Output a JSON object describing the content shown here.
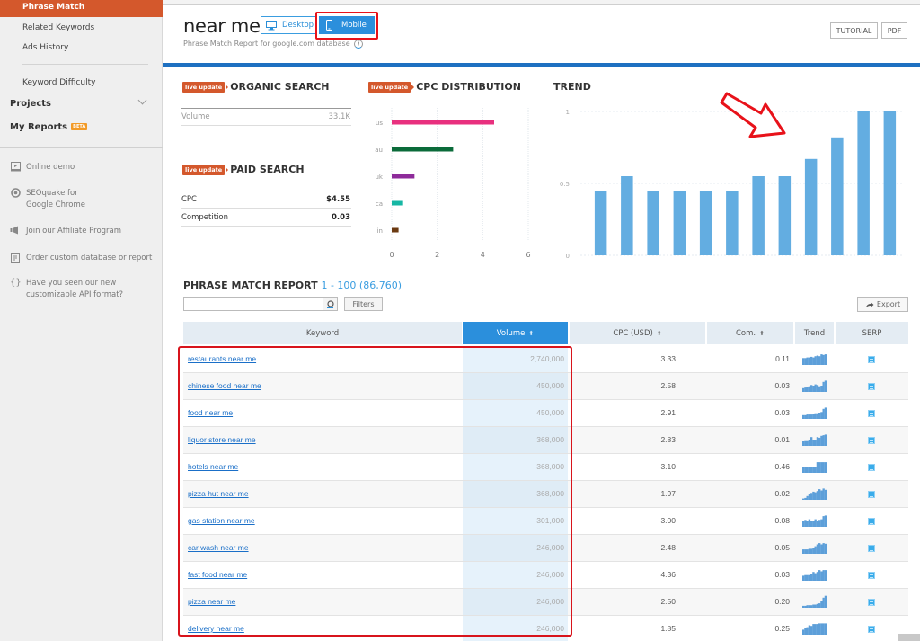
{
  "sidebar": {
    "active_item": "Phrase Match",
    "sub_items": [
      "Related Keywords",
      "Ads History",
      "Keyword Difficulty"
    ],
    "projects_label": "Projects",
    "my_reports_label": "My Reports",
    "beta_badge": "BETA",
    "links": [
      {
        "icon": "monitor-play-icon",
        "label": "Online demo"
      },
      {
        "icon": "target-icon",
        "label": "SEOquake for\nGoogle Chrome"
      },
      {
        "icon": "megaphone-icon",
        "label": "Join our Affiliate Program"
      },
      {
        "icon": "clipboard-icon",
        "label": "Order custom database or report"
      },
      {
        "icon": "braces-icon",
        "label": "Have you seen our new\ncustomizable API format?"
      }
    ]
  },
  "header": {
    "title": "near me",
    "subtitle": "Phrase Match Report for google.com database",
    "info_icon": "i",
    "device_desktop": "Desktop",
    "device_mobile": "Mobile",
    "selected_device": "Mobile",
    "tutorial_label": "TUTORIAL",
    "pdf_label": "PDF"
  },
  "widgets": {
    "live_badge": "live update",
    "organic": {
      "title": "ORGANIC SEARCH",
      "volume_label": "Volume",
      "volume_value": "33.1K"
    },
    "paid": {
      "title": "PAID SEARCH",
      "cpc_label": "CPC",
      "cpc_value": "$4.55",
      "competition_label": "Competition",
      "competition_value": "0.03"
    },
    "cpc_title": "CPC DISTRIBUTION",
    "trend_title": "TREND"
  },
  "chart_data": [
    {
      "type": "bar",
      "orientation": "horizontal",
      "title": "CPC DISTRIBUTION",
      "categories": [
        "us",
        "au",
        "uk",
        "ca",
        "in"
      ],
      "values": [
        4.5,
        2.7,
        1.0,
        0.5,
        0.3
      ],
      "colors": [
        "#e8307e",
        "#0b6b3a",
        "#8e2b9a",
        "#17b7a4",
        "#6b3a12"
      ],
      "xlim": [
        0,
        6
      ],
      "xticks": [
        "0",
        "2",
        "4",
        "6"
      ],
      "grid": true
    },
    {
      "type": "bar",
      "title": "TREND",
      "values": [
        0.45,
        0.55,
        0.45,
        0.45,
        0.45,
        0.45,
        0.55,
        0.55,
        0.67,
        0.82,
        1,
        1
      ],
      "color": "#63ade1",
      "ylim": [
        0,
        1
      ],
      "yticks": [
        "0",
        "0.5",
        "1"
      ],
      "grid": true
    }
  ],
  "report": {
    "title": "PHRASE MATCH REPORT",
    "range": "1 - 100 (86,760)",
    "search_placeholder": "",
    "filters_label": "Filters",
    "export_label": "Export",
    "columns": [
      "Keyword",
      "Volume",
      "CPC (USD)",
      "Com.",
      "Trend",
      "SERP"
    ],
    "sorted_column": "Volume",
    "rows": [
      {
        "keyword": "restaurants near me",
        "volume": "2,740,000",
        "cpc": "3.33",
        "com": "0.11",
        "trend": [
          0.55,
          0.55,
          0.6,
          0.6,
          0.65,
          0.6,
          0.7,
          0.75,
          0.7,
          0.85,
          0.8,
          0.85
        ]
      },
      {
        "keyword": "chinese food near me",
        "volume": "450,000",
        "cpc": "2.58",
        "com": "0.03",
        "trend": [
          0.3,
          0.35,
          0.4,
          0.45,
          0.55,
          0.5,
          0.6,
          0.55,
          0.45,
          0.5,
          0.8,
          0.9
        ]
      },
      {
        "keyword": "food near me",
        "volume": "450,000",
        "cpc": "2.91",
        "com": "0.03",
        "trend": [
          0.3,
          0.3,
          0.35,
          0.35,
          0.35,
          0.4,
          0.45,
          0.45,
          0.5,
          0.55,
          0.8,
          0.9
        ]
      },
      {
        "keyword": "liquor store near me",
        "volume": "368,000",
        "cpc": "2.83",
        "com": "0.01",
        "trend": [
          0.4,
          0.45,
          0.45,
          0.5,
          0.7,
          0.5,
          0.5,
          0.7,
          0.65,
          0.8,
          0.85,
          0.9
        ]
      },
      {
        "keyword": "hotels near me",
        "volume": "368,000",
        "cpc": "3.10",
        "com": "0.46",
        "trend": [
          0.45,
          0.45,
          0.45,
          0.45,
          0.45,
          0.5,
          0.5,
          0.85,
          0.85,
          0.85,
          0.85,
          0.85
        ]
      },
      {
        "keyword": "pizza hut near me",
        "volume": "368,000",
        "cpc": "1.97",
        "com": "0.02",
        "trend": [
          0.1,
          0.15,
          0.3,
          0.45,
          0.55,
          0.65,
          0.6,
          0.7,
          0.85,
          0.75,
          0.9,
          0.8
        ]
      },
      {
        "keyword": "gas station near me",
        "volume": "301,000",
        "cpc": "3.00",
        "com": "0.08",
        "trend": [
          0.5,
          0.55,
          0.5,
          0.6,
          0.5,
          0.5,
          0.6,
          0.5,
          0.55,
          0.6,
          0.85,
          0.9
        ]
      },
      {
        "keyword": "car wash near me",
        "volume": "246,000",
        "cpc": "2.48",
        "com": "0.05",
        "trend": [
          0.35,
          0.35,
          0.35,
          0.4,
          0.4,
          0.45,
          0.6,
          0.75,
          0.85,
          0.75,
          0.85,
          0.8
        ]
      },
      {
        "keyword": "fast food near me",
        "volume": "246,000",
        "cpc": "4.36",
        "com": "0.03",
        "trend": [
          0.4,
          0.45,
          0.45,
          0.45,
          0.5,
          0.7,
          0.6,
          0.7,
          0.85,
          0.75,
          0.85,
          0.85
        ]
      },
      {
        "keyword": "pizza near me",
        "volume": "246,000",
        "cpc": "2.50",
        "com": "0.20",
        "trend": [
          0.15,
          0.15,
          0.2,
          0.2,
          0.2,
          0.25,
          0.25,
          0.3,
          0.35,
          0.5,
          0.8,
          0.95
        ]
      },
      {
        "keyword": "delivery near me",
        "volume": "246,000",
        "cpc": "1.85",
        "com": "0.25",
        "trend": [
          0.4,
          0.5,
          0.6,
          0.75,
          0.7,
          0.85,
          0.85,
          0.85,
          0.9,
          0.9,
          0.9,
          0.9
        ]
      }
    ]
  },
  "colors": {
    "brand_orange": "#d4582c",
    "accent_blue": "#2b8fdc",
    "link_blue": "#1a6fc8",
    "highlight_red": "#e8121a"
  }
}
